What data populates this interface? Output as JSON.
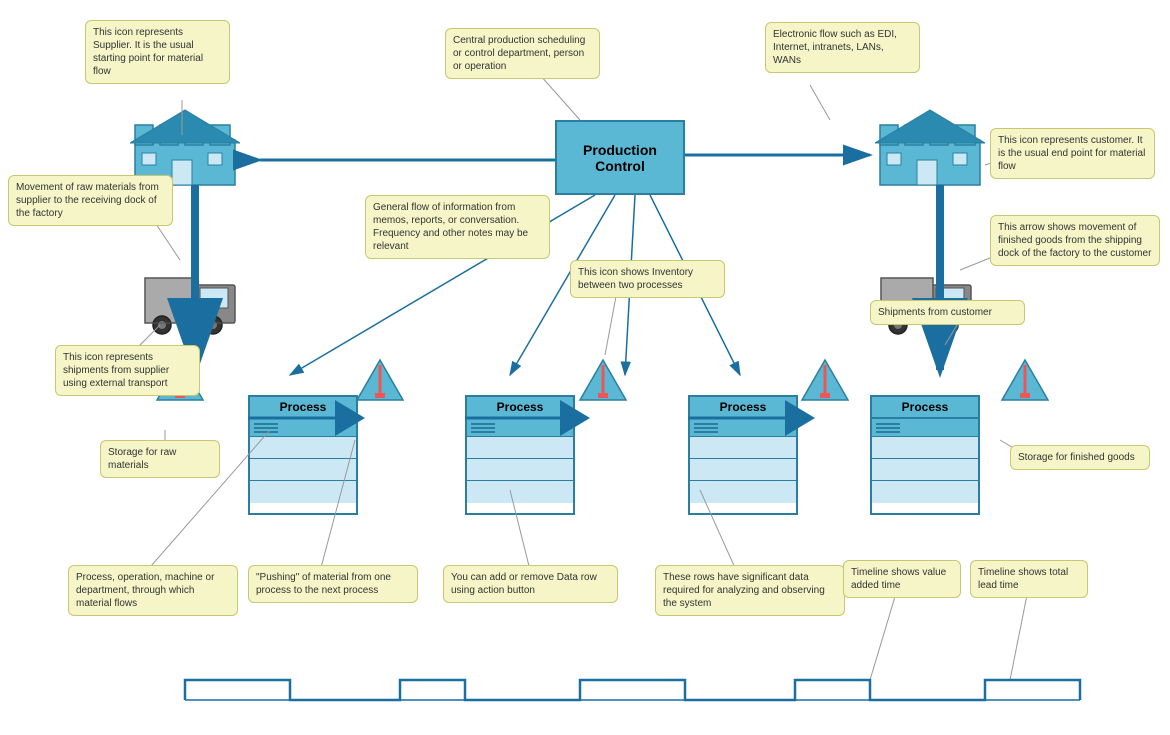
{
  "callouts": {
    "supplier_desc": "This icon represents Supplier. It is the usual starting point for material flow",
    "prod_control_desc": "Central production scheduling or control department, person or operation",
    "electronic_flow": "Electronic flow such as EDI, Internet, intranets, LANs, WANs",
    "customer_desc": "This icon represents customer. It is the usual end point for material flow",
    "raw_movement": "Movement of raw materials from supplier to the receiving dock of the factory",
    "info_flow": "General flow of information from memos, reports, or conversation. Frequency and other notes may be relevant",
    "inventory_desc": "This icon shows Inventory between two processes",
    "finished_movement": "This arrow shows movement of finished goods from the shipping dock of the factory to the customer",
    "shipments_customer": "Shipments from customer",
    "supplier_transport": "This icon represents shipments from supplier using external transport",
    "storage_raw": "Storage for raw materials",
    "storage_finished": "Storage for finished goods",
    "process_desc": "Process, operation, machine or department, through which material flows",
    "pushing_desc": "\"Pushing\" of material from one process to the next process",
    "data_row_desc": "You can add or remove Data row using action button",
    "significant_rows": "These rows have significant data required for analyzing and observing the system",
    "timeline_value": "Timeline shows value added time",
    "timeline_lead": "Timeline shows total lead time"
  },
  "prod_control": {
    "label": "Production\nControl"
  },
  "processes": [
    {
      "label": "Process"
    },
    {
      "label": "Process"
    },
    {
      "label": "Process"
    },
    {
      "label": "Process"
    }
  ]
}
